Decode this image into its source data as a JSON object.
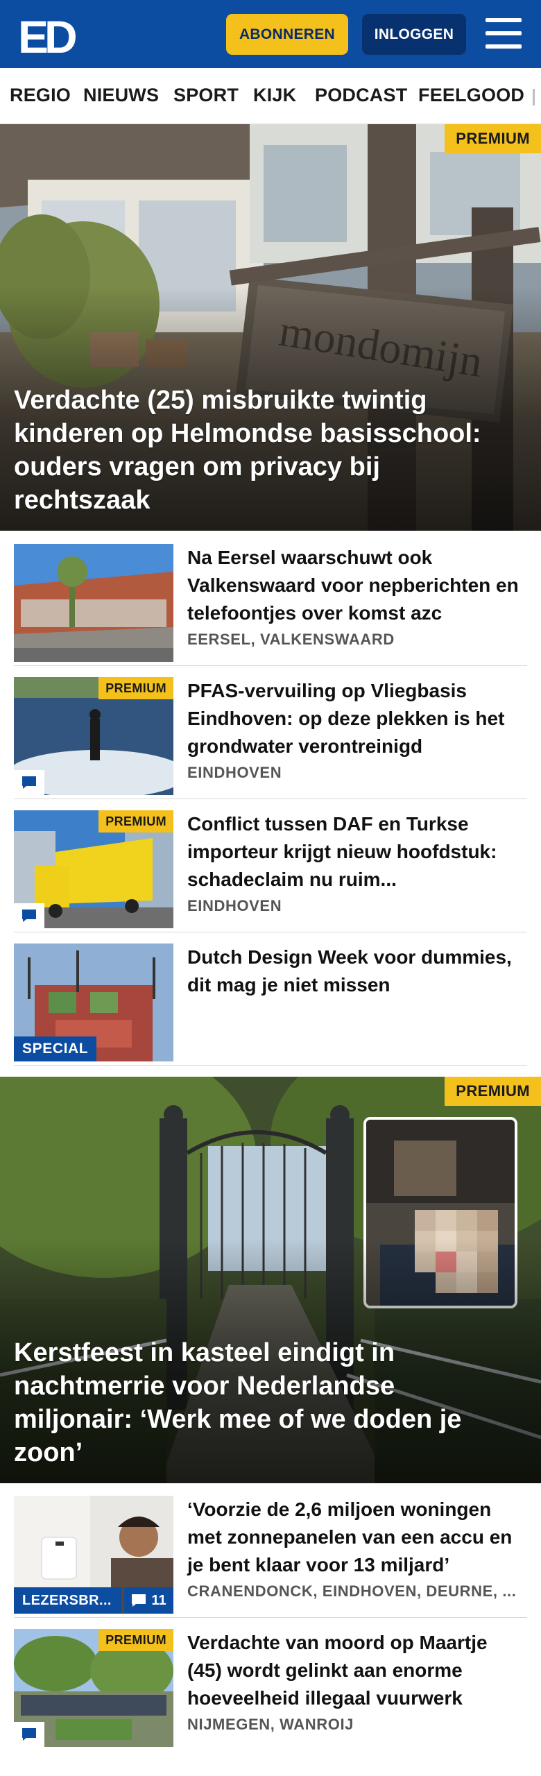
{
  "header": {
    "logo_text": "ED",
    "subscribe_label": "ABONNEREN",
    "login_label": "INLOGGEN",
    "menu_icon": "hamburger-menu-icon",
    "colors": {
      "brand": "#0c4da2",
      "accent": "#f3c01c"
    }
  },
  "nav": {
    "items": [
      "REGIO",
      "NIEUWS",
      "SPORT",
      "KIJK",
      "PODCAST",
      "FEELGOOD"
    ]
  },
  "hero1": {
    "badge": "PREMIUM",
    "title": "Verdachte (25) misbruikte twintig kinderen op Helmondse basisschool: ouders vragen om privacy bij rechtszaak",
    "image_sign_text": "mondomijn"
  },
  "articles1": [
    {
      "title": "Na Eersel waarschuwt ook Valkenswaard voor nepberichten en telefoontjes over komst azc",
      "location": "EERSEL, VALKENSWAARD",
      "badge": ""
    },
    {
      "title": "PFAS-vervuiling op Vliegbasis Eindhoven: op deze plekken is het grondwater verontreinigd",
      "location": "EINDHOVEN",
      "badge": "PREMIUM"
    },
    {
      "title": "Conflict tussen DAF en Turkse importeur krijgt nieuw hoofdstuk: schadeclaim nu ruim...",
      "location": "EINDHOVEN",
      "badge": "PREMIUM"
    },
    {
      "title": "Dutch Design Week voor dummies, dit mag je niet missen",
      "location": "",
      "badge": "SPECIAL"
    }
  ],
  "hero2": {
    "badge": "PREMIUM",
    "title": "Kerstfeest in kasteel eindigt in nachtmerrie voor Nederlandse miljonair: ‘Werk mee of we doden je zoon’"
  },
  "articles2": [
    {
      "title": "‘Voorzie de 2,6 miljoen woningen met zonnepanelen van een accu en je bent klaar voor 13 miljard’",
      "location": "CRANENDONCK, EINDHOVEN, DEURNE, ...",
      "badge": "LEZERSBR...",
      "comment_count": "11"
    },
    {
      "title": "Verdachte van moord op Maartje (45) wordt gelinkt aan enorme hoeveelheid illegaal vuurwerk",
      "location": "NIJMEGEN, WANROIJ",
      "badge": "PREMIUM"
    }
  ]
}
